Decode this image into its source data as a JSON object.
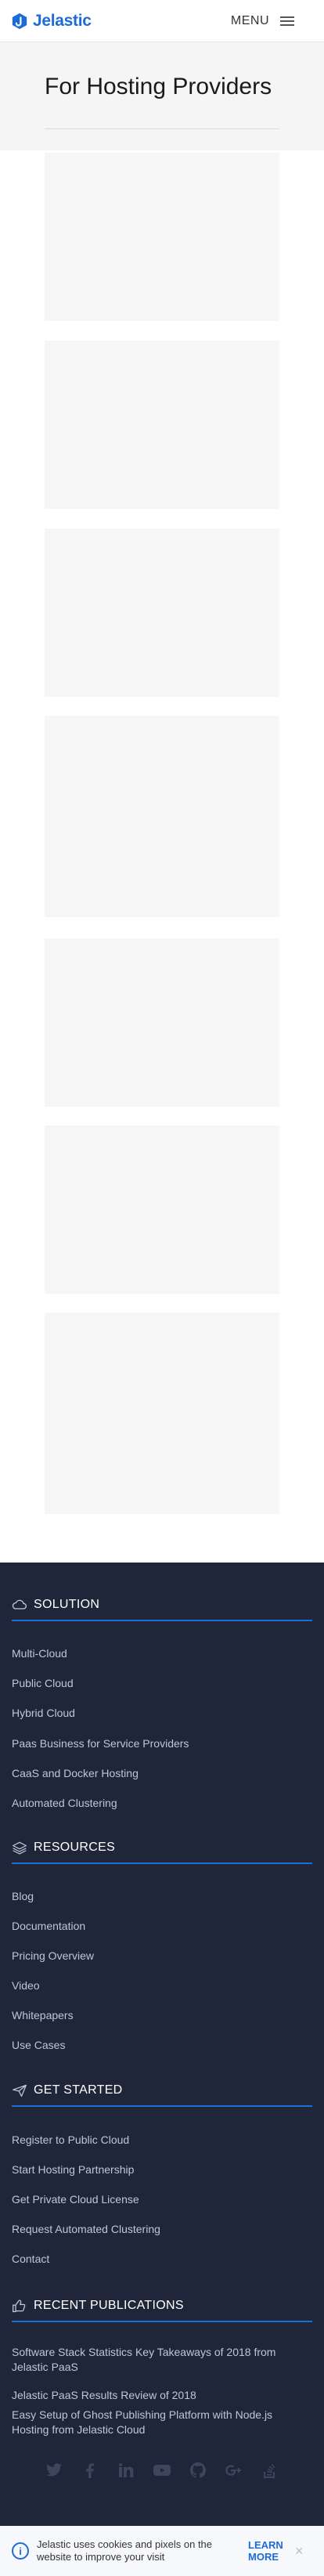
{
  "header": {
    "logo_text": "Jelastic",
    "menu_label": "MENU"
  },
  "hero": {
    "title": "For Hosting Providers"
  },
  "footer": {
    "solution": {
      "heading": "SOLUTION",
      "links": [
        "Multi-Cloud",
        "Public Cloud",
        "Hybrid Cloud",
        "Paas Business for Service Providers",
        "CaaS and Docker Hosting",
        "Automated Clustering"
      ]
    },
    "resources": {
      "heading": "RESOURCES",
      "links": [
        "Blog",
        "Documentation",
        "Pricing Overview",
        "Video",
        "Whitepapers",
        "Use Cases"
      ]
    },
    "get_started": {
      "heading": "GET STARTED",
      "links": [
        "Register to Public Cloud",
        "Start Hosting Partnership",
        "Get Private Cloud License",
        "Request Automated Clustering",
        "Contact"
      ]
    },
    "recent_publications": {
      "heading": "RECENT PUBLICATIONS",
      "items": [
        "Software Stack Statistics Key Takeaways of 2018 from Jelastic PaaS",
        "Jelastic PaaS Results Review of 2018",
        "Easy Setup of Ghost Publishing Platform with Node.js Hosting from Jelastic Cloud"
      ]
    },
    "social_icons": [
      "twitter-icon",
      "facebook-icon",
      "linkedin-icon",
      "youtube-icon",
      "github-icon",
      "google-plus-icon",
      "stackoverflow-icon"
    ]
  },
  "cookie": {
    "message": "Jelastic uses cookies and pixels on the website to improve your visit",
    "learn_more": "LEARN MORE",
    "close": "×"
  },
  "colors": {
    "brand": "#1d6bd6",
    "footer_bg": "#1f2639",
    "accent_line": "#1a6ed8"
  }
}
